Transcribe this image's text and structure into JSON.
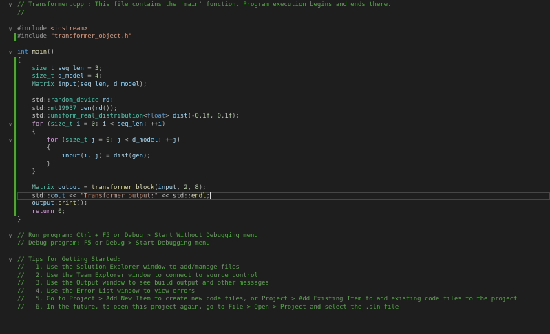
{
  "editor": {
    "file": "Transformer.cpp",
    "cursor_line": 25,
    "colors": {
      "background": "#1e1e1e",
      "comment": "#57a64a",
      "keyword": "#569cd6",
      "type": "#4ec9b0",
      "change_bar": "#5a9e3a"
    },
    "changed_lines": [
      5,
      8,
      9,
      10,
      11,
      12,
      13,
      14,
      15,
      16,
      17,
      18,
      19,
      20,
      21,
      22,
      23,
      24,
      25,
      26,
      27
    ],
    "lines": [
      {
        "fold": true,
        "toks": [
          [
            "// Transformer.cpp : This file contains the 'main' function. Program execution begins and ends there.",
            "cm"
          ]
        ]
      },
      {
        "toks": [
          [
            "//",
            "cm"
          ]
        ]
      },
      {
        "toks": []
      },
      {
        "fold": true,
        "toks": [
          [
            "#include ",
            "pp"
          ],
          [
            "<iostream>",
            "str"
          ]
        ]
      },
      {
        "toks": [
          [
            "#include ",
            "pp"
          ],
          [
            "\"transformer_object.h\"",
            "str"
          ]
        ]
      },
      {
        "toks": []
      },
      {
        "fold": true,
        "toks": [
          [
            "int",
            "kw"
          ],
          [
            " ",
            "pun"
          ],
          [
            "main",
            "fn"
          ],
          [
            "()",
            "pun"
          ]
        ]
      },
      {
        "toks": [
          [
            "{",
            "pun"
          ]
        ]
      },
      {
        "toks": [
          [
            "    ",
            "pun"
          ],
          [
            "size_t",
            "ty"
          ],
          [
            " seq_len",
            "var"
          ],
          [
            " = ",
            "pun"
          ],
          [
            "3",
            "num"
          ],
          [
            ";",
            "pun"
          ]
        ]
      },
      {
        "toks": [
          [
            "    ",
            "pun"
          ],
          [
            "size_t",
            "ty"
          ],
          [
            " d_model",
            "var"
          ],
          [
            " = ",
            "pun"
          ],
          [
            "4",
            "num"
          ],
          [
            ";",
            "pun"
          ]
        ]
      },
      {
        "toks": [
          [
            "    ",
            "pun"
          ],
          [
            "Matrix",
            "ty"
          ],
          [
            " input",
            "var"
          ],
          [
            "(",
            "pun"
          ],
          [
            "seq_len",
            "var"
          ],
          [
            ", ",
            "pun"
          ],
          [
            "d_model",
            "var"
          ],
          [
            ");",
            "pun"
          ]
        ]
      },
      {
        "toks": []
      },
      {
        "toks": [
          [
            "    ",
            "pun"
          ],
          [
            "std",
            "ns"
          ],
          [
            "::",
            "pun"
          ],
          [
            "random_device",
            "ty"
          ],
          [
            " rd",
            "var"
          ],
          [
            ";",
            "pun"
          ]
        ]
      },
      {
        "toks": [
          [
            "    ",
            "pun"
          ],
          [
            "std",
            "ns"
          ],
          [
            "::",
            "pun"
          ],
          [
            "mt19937",
            "ty"
          ],
          [
            " gen",
            "var"
          ],
          [
            "(",
            "pun"
          ],
          [
            "rd",
            "var"
          ],
          [
            "());",
            "pun"
          ]
        ]
      },
      {
        "toks": [
          [
            "    ",
            "pun"
          ],
          [
            "std",
            "ns"
          ],
          [
            "::",
            "pun"
          ],
          [
            "uniform_real_distribution",
            "ty"
          ],
          [
            "<",
            "pun"
          ],
          [
            "float",
            "kw"
          ],
          [
            "> ",
            "pun"
          ],
          [
            "dist",
            "var"
          ],
          [
            "(-",
            "pun"
          ],
          [
            "0.1f",
            "num"
          ],
          [
            ", ",
            "pun"
          ],
          [
            "0.1f",
            "num"
          ],
          [
            ");",
            "pun"
          ]
        ]
      },
      {
        "fold": true,
        "toks": [
          [
            "    ",
            "pun"
          ],
          [
            "for",
            "ctl"
          ],
          [
            " (",
            "pun"
          ],
          [
            "size_t",
            "ty"
          ],
          [
            " i",
            "var"
          ],
          [
            " = ",
            "pun"
          ],
          [
            "0",
            "num"
          ],
          [
            "; ",
            "pun"
          ],
          [
            "i",
            "var"
          ],
          [
            " < ",
            "pun"
          ],
          [
            "seq_len",
            "var"
          ],
          [
            "; ++",
            "pun"
          ],
          [
            "i",
            "var"
          ],
          [
            ")",
            "pun"
          ]
        ]
      },
      {
        "toks": [
          [
            "    {",
            "pun"
          ]
        ]
      },
      {
        "fold": true,
        "toks": [
          [
            "        ",
            "pun"
          ],
          [
            "for",
            "ctl"
          ],
          [
            " (",
            "pun"
          ],
          [
            "size_t",
            "ty"
          ],
          [
            " j",
            "var"
          ],
          [
            " = ",
            "pun"
          ],
          [
            "0",
            "num"
          ],
          [
            "; ",
            "pun"
          ],
          [
            "j",
            "var"
          ],
          [
            " < ",
            "pun"
          ],
          [
            "d_model",
            "var"
          ],
          [
            "; ++",
            "pun"
          ],
          [
            "j",
            "var"
          ],
          [
            ")",
            "pun"
          ]
        ]
      },
      {
        "toks": [
          [
            "        {",
            "pun"
          ]
        ]
      },
      {
        "toks": [
          [
            "            ",
            "pun"
          ],
          [
            "input",
            "var"
          ],
          [
            "(",
            "pun"
          ],
          [
            "i",
            "var"
          ],
          [
            ", ",
            "pun"
          ],
          [
            "j",
            "var"
          ],
          [
            ") = ",
            "pun"
          ],
          [
            "dist",
            "var"
          ],
          [
            "(",
            "pun"
          ],
          [
            "gen",
            "var"
          ],
          [
            ");",
            "pun"
          ]
        ]
      },
      {
        "toks": [
          [
            "        }",
            "pun"
          ]
        ]
      },
      {
        "toks": [
          [
            "    }",
            "pun"
          ]
        ]
      },
      {
        "toks": []
      },
      {
        "toks": [
          [
            "    ",
            "pun"
          ],
          [
            "Matrix",
            "ty"
          ],
          [
            " output",
            "var"
          ],
          [
            " = ",
            "pun"
          ],
          [
            "transformer_block",
            "fn"
          ],
          [
            "(",
            "pun"
          ],
          [
            "input",
            "var"
          ],
          [
            ", ",
            "pun"
          ],
          [
            "2",
            "num"
          ],
          [
            ", ",
            "pun"
          ],
          [
            "8",
            "num"
          ],
          [
            ");",
            "pun"
          ]
        ]
      },
      {
        "toks": [
          [
            "    ",
            "pun"
          ],
          [
            "std",
            "ns"
          ],
          [
            "::",
            "pun"
          ],
          [
            "cout",
            "var"
          ],
          [
            " << ",
            "pun"
          ],
          [
            "\"Transformer output:\"",
            "str"
          ],
          [
            " << ",
            "pun"
          ],
          [
            "std",
            "ns"
          ],
          [
            "::",
            "pun"
          ],
          [
            "endl",
            "fn"
          ],
          [
            ";",
            "pun"
          ]
        ]
      },
      {
        "toks": [
          [
            "    ",
            "pun"
          ],
          [
            "output",
            "var"
          ],
          [
            ".",
            "pun"
          ],
          [
            "print",
            "fn"
          ],
          [
            "();",
            "pun"
          ]
        ]
      },
      {
        "toks": [
          [
            "    ",
            "pun"
          ],
          [
            "return",
            "ctl"
          ],
          [
            " ",
            "pun"
          ],
          [
            "0",
            "num"
          ],
          [
            ";",
            "pun"
          ]
        ]
      },
      {
        "toks": [
          [
            "}",
            "pun"
          ]
        ]
      },
      {
        "toks": []
      },
      {
        "fold": true,
        "toks": [
          [
            "// Run program: Ctrl + F5 or Debug > Start Without Debugging menu",
            "cm"
          ]
        ]
      },
      {
        "toks": [
          [
            "// Debug program: F5 or Debug > Start Debugging menu",
            "cm"
          ]
        ]
      },
      {
        "toks": []
      },
      {
        "fold": true,
        "toks": [
          [
            "// Tips for Getting Started: ",
            "cm"
          ]
        ]
      },
      {
        "toks": [
          [
            "//   1. Use the Solution Explorer window to add/manage files",
            "cm"
          ]
        ]
      },
      {
        "toks": [
          [
            "//   2. Use the Team Explorer window to connect to source control",
            "cm"
          ]
        ]
      },
      {
        "toks": [
          [
            "//   3. Use the Output window to see build output and other messages",
            "cm"
          ]
        ]
      },
      {
        "toks": [
          [
            "//   4. Use the Error List window to view errors",
            "cm"
          ]
        ]
      },
      {
        "toks": [
          [
            "//   5. Go to Project > Add New Item to create new code files, or Project > Add Existing Item to add existing code files to the project",
            "cm"
          ]
        ]
      },
      {
        "toks": [
          [
            "//   6. In the future, to open this project again, go to File > Open > Project and select the .sln file",
            "cm"
          ]
        ]
      }
    ]
  }
}
